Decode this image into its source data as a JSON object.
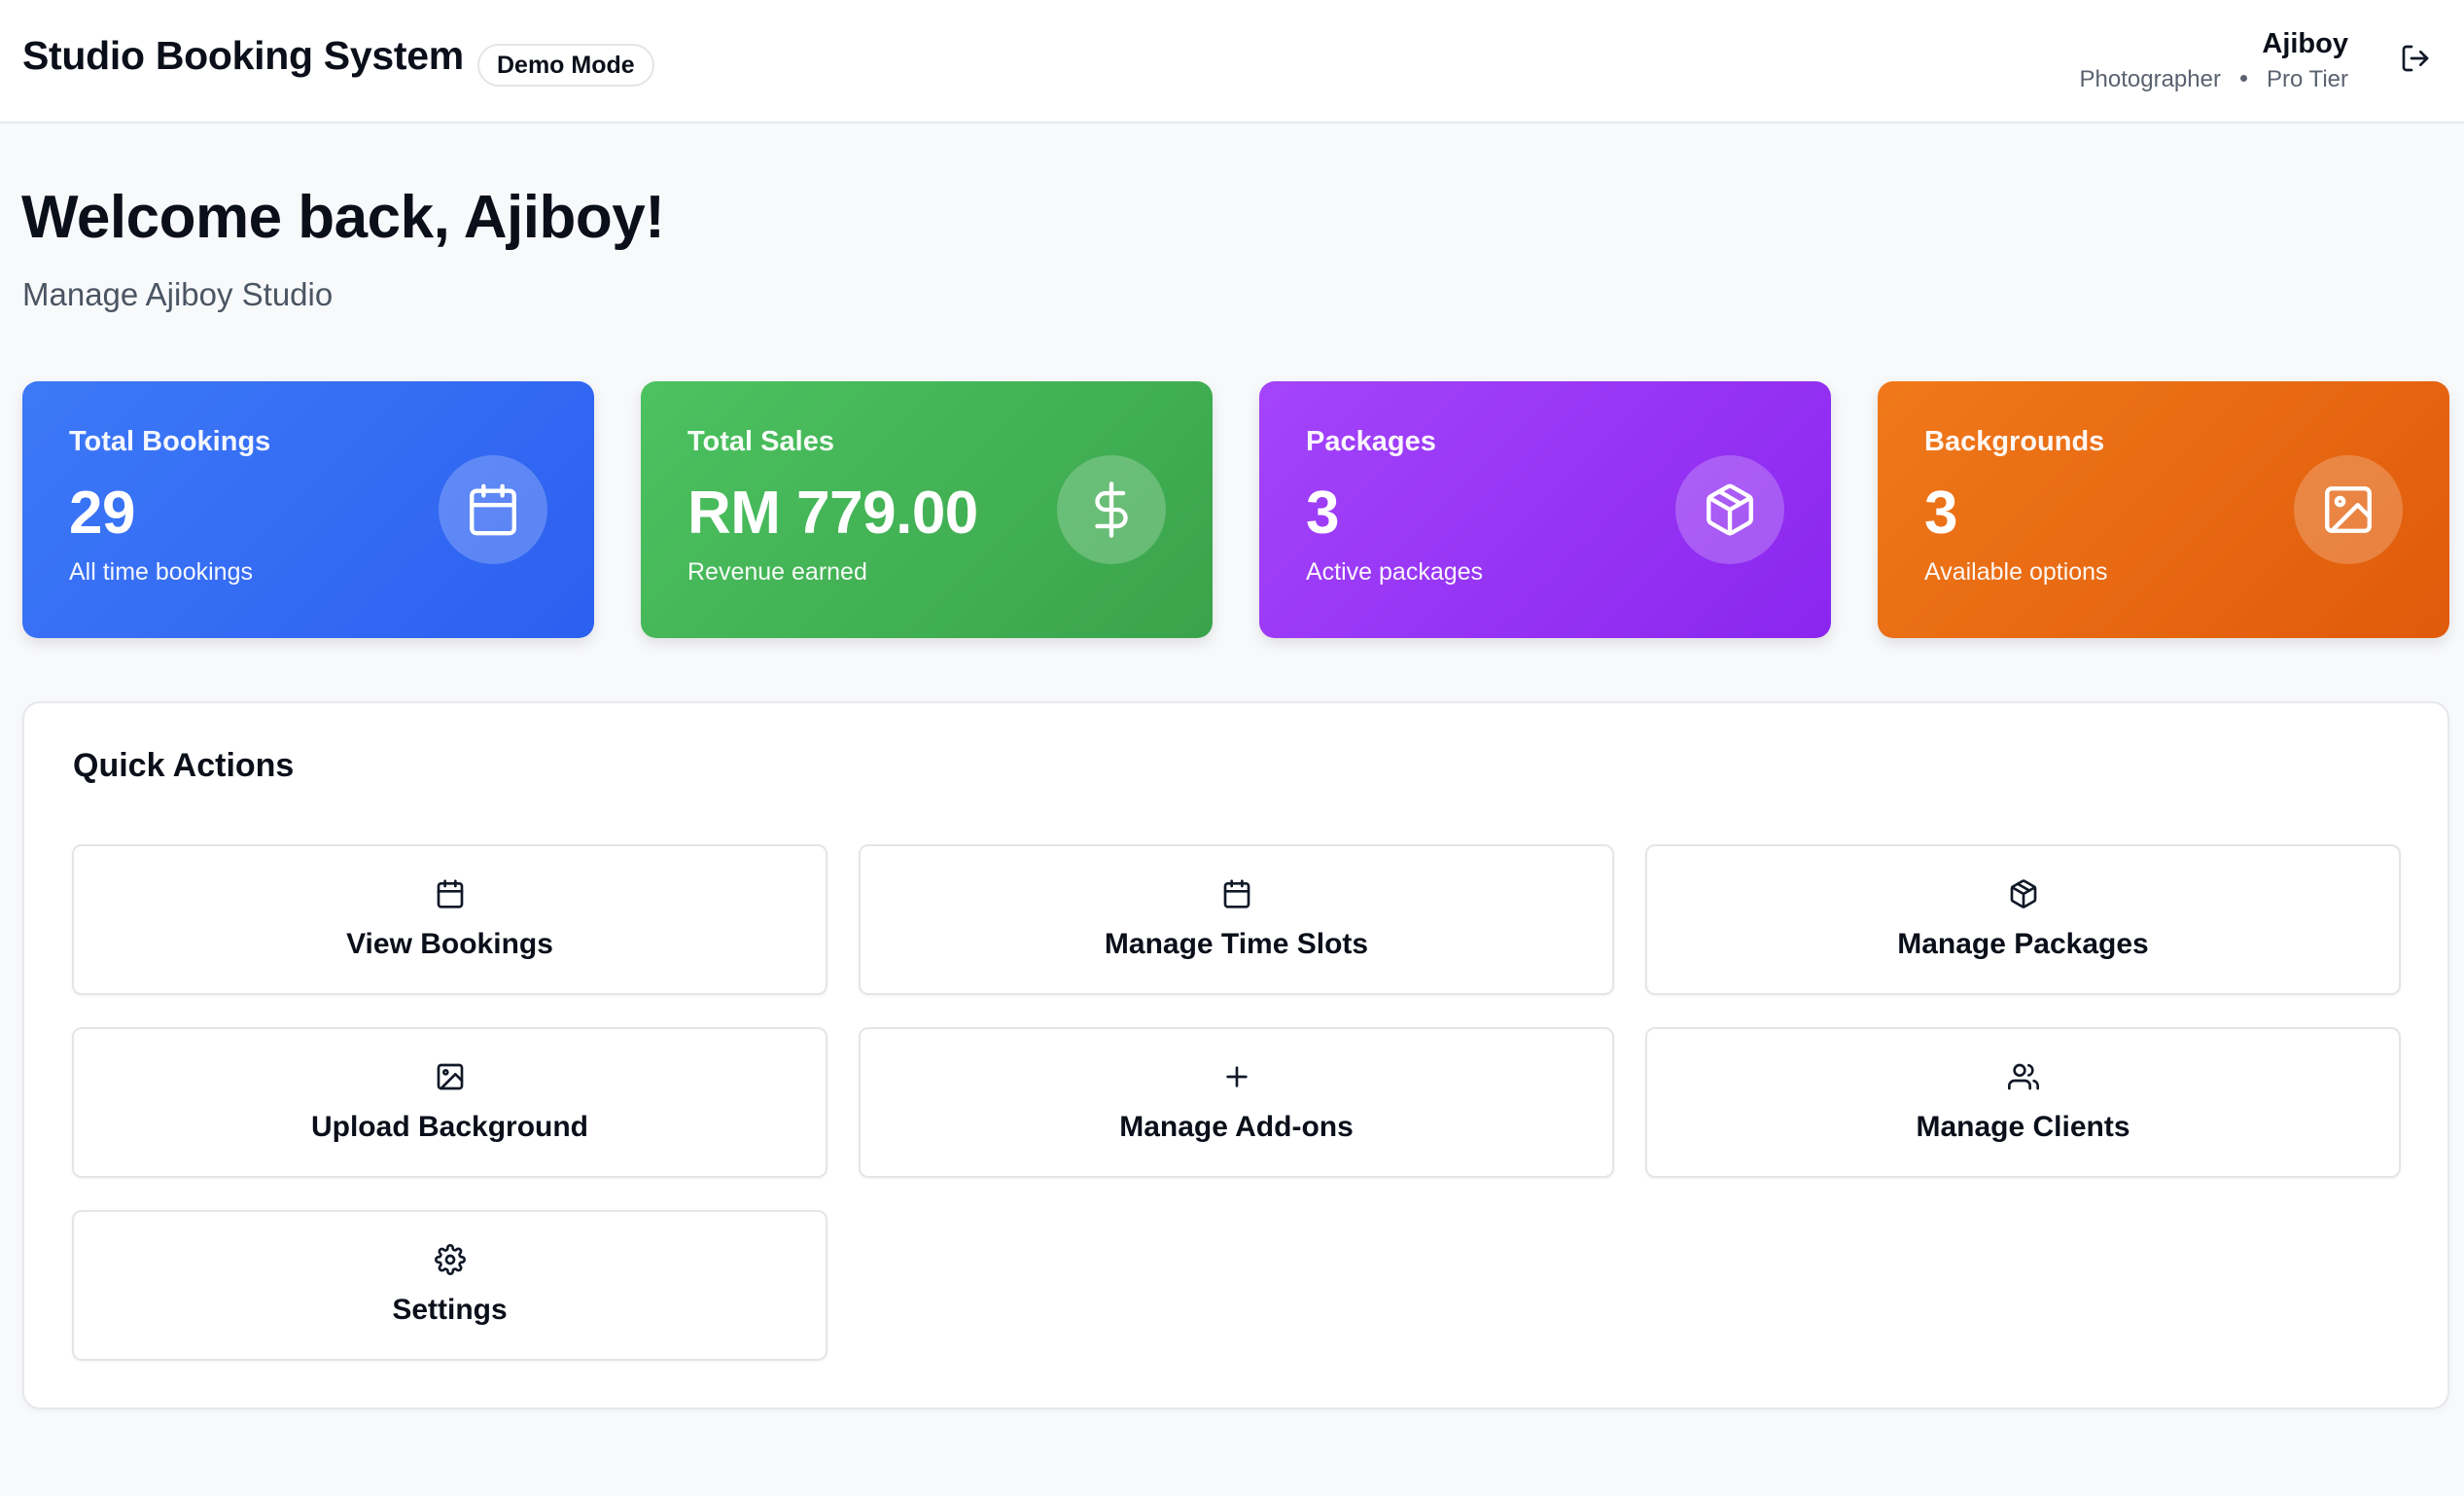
{
  "header": {
    "app_title": "Studio Booking System",
    "mode_badge": "Demo Mode",
    "user_name": "Ajiboy",
    "user_role": "Photographer",
    "user_tier": "Pro Tier",
    "logout_icon": "logout-icon"
  },
  "welcome": {
    "title": "Welcome back, Ajiboy!",
    "subtitle": "Manage Ajiboy Studio"
  },
  "stats": [
    {
      "label": "Total Bookings",
      "value": "29",
      "sub": "All time bookings",
      "icon": "calendar-icon",
      "color": "#3b73f6"
    },
    {
      "label": "Total Sales",
      "value": "RM 779.00",
      "sub": "Revenue earned",
      "icon": "dollar-icon",
      "color": "#45b556"
    },
    {
      "label": "Packages",
      "value": "3",
      "sub": "Active packages",
      "icon": "package-icon",
      "color": "#9a36f6"
    },
    {
      "label": "Backgrounds",
      "value": "3",
      "sub": "Available options",
      "icon": "image-icon",
      "color": "#ea6a12"
    }
  ],
  "quick_actions": {
    "title": "Quick Actions",
    "items": [
      {
        "label": "View Bookings",
        "icon": "calendar-icon"
      },
      {
        "label": "Manage Time Slots",
        "icon": "calendar-icon"
      },
      {
        "label": "Manage Packages",
        "icon": "package-icon"
      },
      {
        "label": "Upload Background",
        "icon": "image-icon"
      },
      {
        "label": "Manage Add-ons",
        "icon": "plus-icon"
      },
      {
        "label": "Manage Clients",
        "icon": "users-icon"
      },
      {
        "label": "Settings",
        "icon": "gear-icon"
      }
    ]
  }
}
